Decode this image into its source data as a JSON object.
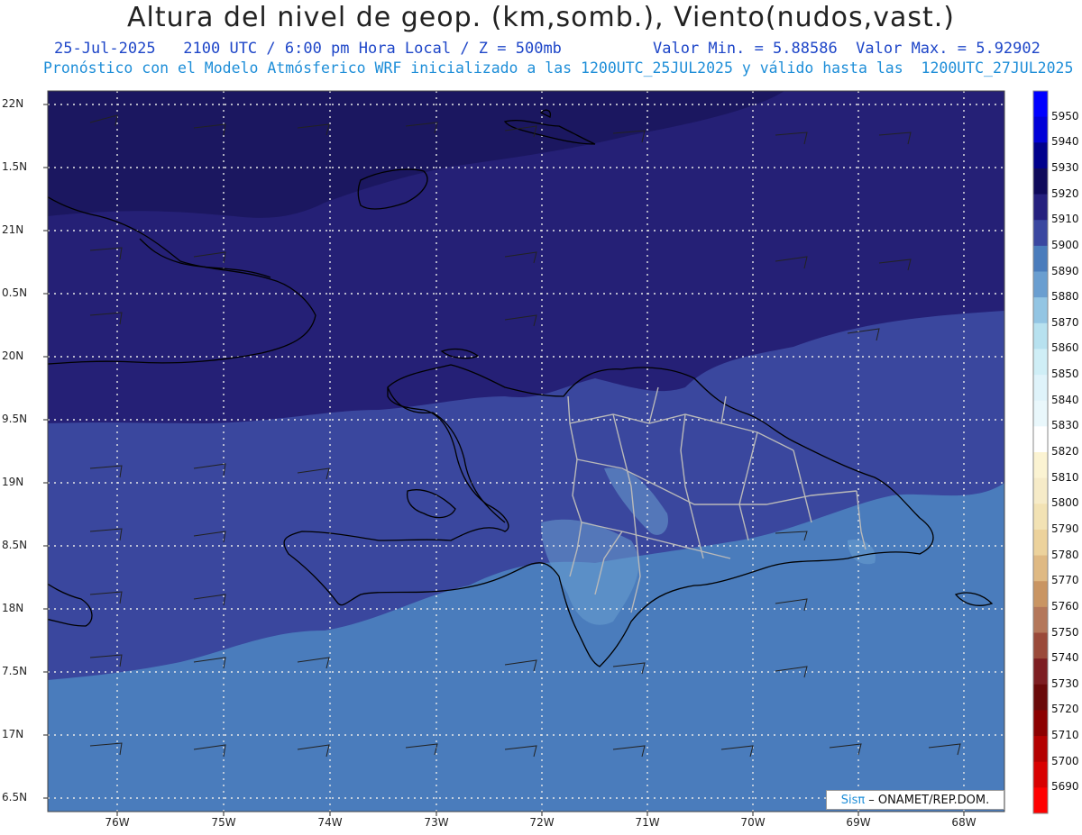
{
  "header": {
    "title": "Altura del nivel de geop. (km,somb.), Viento(nudos,vast.)",
    "date_line": "25-Jul-2025   2100 UTC / 6:00 pm Hora Local / Z = 500mb",
    "minmax_line": "Valor Min. = 5.88586  Valor Max. = 5.92902",
    "model_line": "Pronóstico con el Modelo Atmósferico WRF inicializado a las 1200UTC_25JUL2025 y válido hasta las  1200UTC_27JUL2025"
  },
  "latitude_labels": [
    "22N",
    "1.5N",
    "21N",
    "0.5N",
    "20N",
    "9.5N",
    "19N",
    "8.5N",
    "18N",
    "7.5N",
    "17N",
    "6.5N"
  ],
  "longitude_labels": [
    "76W",
    "75W",
    "74W",
    "73W",
    "72W",
    "71W",
    "70W",
    "69W",
    "68W"
  ],
  "colorbar": {
    "labels": [
      "5950",
      "5940",
      "5930",
      "5920",
      "5910",
      "5900",
      "5890",
      "5880",
      "5870",
      "5860",
      "5850",
      "5840",
      "5830",
      "5820",
      "5810",
      "5800",
      "5790",
      "5780",
      "5770",
      "5760",
      "5750",
      "5740",
      "5730",
      "5720",
      "5710",
      "5700",
      "5690"
    ],
    "colors": [
      "#0000ff",
      "#0000d8",
      "#00008c",
      "#0f0a5a",
      "#25207e",
      "#3a47a0",
      "#4a7cbc",
      "#6a9ed0",
      "#93c5e3",
      "#b7e1ef",
      "#cfeef6",
      "#dff3fa",
      "#e9f7fb",
      "#ffffff",
      "#fbf3d2",
      "#f6ebc8",
      "#f2e2b4",
      "#ecd29c",
      "#dfb983",
      "#c99563",
      "#b4775a",
      "#9a4a3a",
      "#7d1e22",
      "#6a0a0a",
      "#8c0000",
      "#b40000",
      "#d80000",
      "#ff0000"
    ]
  },
  "credit": {
    "sis": "Sisπ",
    "org": "– ONAMET/REP.DOM."
  },
  "colors": {
    "dark_band": "#1b1760",
    "mid_band": "#252076",
    "blue_band": "#3a479e",
    "light_band": "#4a7cbc",
    "coast": "#000000",
    "borders": "#b9b9b9"
  }
}
